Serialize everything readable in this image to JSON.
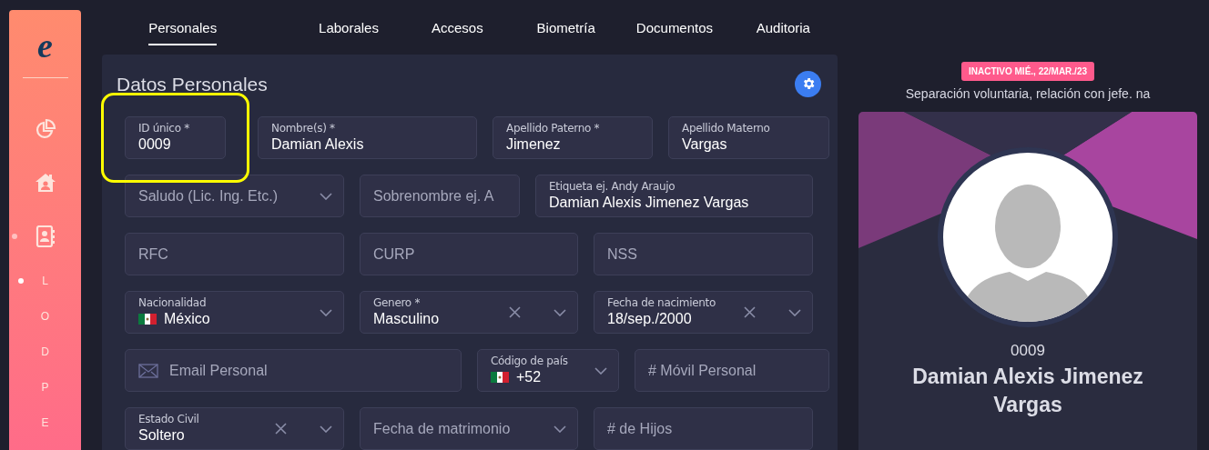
{
  "sidebar": {
    "logo": "e",
    "items": [
      {
        "kind": "chart",
        "selected": false
      },
      {
        "kind": "home",
        "selected": false
      },
      {
        "kind": "contacts",
        "selected": true
      },
      {
        "kind": "letter",
        "label": "L",
        "selected": true
      },
      {
        "kind": "letter",
        "label": "O",
        "selected": false
      },
      {
        "kind": "letter",
        "label": "D",
        "selected": false
      },
      {
        "kind": "letter",
        "label": "P",
        "selected": false
      },
      {
        "kind": "letter",
        "label": "E",
        "selected": false
      }
    ]
  },
  "tabs": [
    {
      "label": "Personales",
      "selected": true
    },
    {
      "label": "Laborales",
      "selected": false
    },
    {
      "label": "Accesos",
      "selected": false
    },
    {
      "label": "Biometría",
      "selected": false
    },
    {
      "label": "Documentos",
      "selected": false
    },
    {
      "label": "Auditoria",
      "selected": false
    }
  ],
  "form": {
    "title": "Datos Personales",
    "rows": [
      [
        {
          "kind": "text",
          "label": "ID único *",
          "value": "0009",
          "highlighted": true,
          "dropdown": false,
          "clear": false,
          "flag": false
        },
        {
          "kind": "text",
          "label": "Nombre(s) *",
          "value": "Damian Alexis",
          "highlighted": false,
          "dropdown": false,
          "clear": false,
          "flag": false
        },
        {
          "kind": "text",
          "label": "Apellido Paterno *",
          "value": "Jimenez",
          "highlighted": false,
          "dropdown": false,
          "clear": false,
          "flag": false
        },
        {
          "kind": "text",
          "label": "Apellido Materno",
          "value": "Vargas",
          "highlighted": false,
          "dropdown": false,
          "clear": false,
          "flag": false
        }
      ],
      [
        {
          "kind": "text",
          "placeholder": "Saludo (Lic. Ing. Etc.)",
          "highlighted": false,
          "dropdown": true,
          "clear": false,
          "flag": false
        },
        {
          "kind": "text",
          "placeholder": "Sobrenombre ej. A",
          "highlighted": false,
          "dropdown": false,
          "clear": false,
          "flag": false
        },
        {
          "kind": "text",
          "label": "Etiqueta ej. Andy Araujo",
          "value": "Damian Alexis Jimenez Vargas",
          "highlighted": false,
          "dropdown": false,
          "clear": false,
          "flag": false
        }
      ],
      [
        {
          "kind": "text",
          "placeholder": "RFC",
          "highlighted": false,
          "dropdown": false,
          "clear": false,
          "flag": false
        },
        {
          "kind": "text",
          "placeholder": "CURP",
          "highlighted": false,
          "dropdown": false,
          "clear": false,
          "flag": false
        },
        {
          "kind": "text",
          "placeholder": "NSS",
          "highlighted": false,
          "dropdown": false,
          "clear": false,
          "flag": false
        }
      ],
      [
        {
          "kind": "text",
          "label": "Nacionalidad",
          "value": "México",
          "highlighted": false,
          "dropdown": true,
          "clear": false,
          "flag": true
        },
        {
          "kind": "text",
          "label": "Genero *",
          "value": "Masculino",
          "highlighted": false,
          "dropdown": true,
          "clear": true,
          "flag": false
        },
        {
          "kind": "text",
          "label": "Fecha de nacimiento",
          "value": "18/sep./2000",
          "highlighted": false,
          "dropdown": true,
          "clear": true,
          "flag": false
        }
      ],
      [
        {
          "kind": "email",
          "placeholder": "Email Personal",
          "highlighted": false,
          "dropdown": false,
          "clear": false,
          "flag": false
        },
        {
          "kind": "text",
          "label": "Código de país",
          "value": "+52",
          "highlighted": false,
          "dropdown": true,
          "clear": false,
          "flag": true
        },
        {
          "kind": "text",
          "placeholder": "# Móvil Personal",
          "highlighted": false,
          "dropdown": false,
          "clear": false,
          "flag": false
        }
      ],
      [
        {
          "kind": "text",
          "label": "Estado Civil",
          "value": "Soltero",
          "highlighted": false,
          "dropdown": true,
          "clear": true,
          "flag": false
        },
        {
          "kind": "text",
          "placeholder": "Fecha de matrimonio",
          "highlighted": false,
          "dropdown": true,
          "clear": false,
          "flag": false
        },
        {
          "kind": "text",
          "placeholder": "# de Hijos",
          "highlighted": false,
          "dropdown": false,
          "clear": false,
          "flag": false
        }
      ]
    ]
  },
  "profile": {
    "status_badge": "INACTIVO MIÉ., 22/MAR./23",
    "reason": "Separación voluntaria, relación con jefe. na",
    "id": "0009",
    "name": "Damian Alexis Jimenez Vargas"
  }
}
